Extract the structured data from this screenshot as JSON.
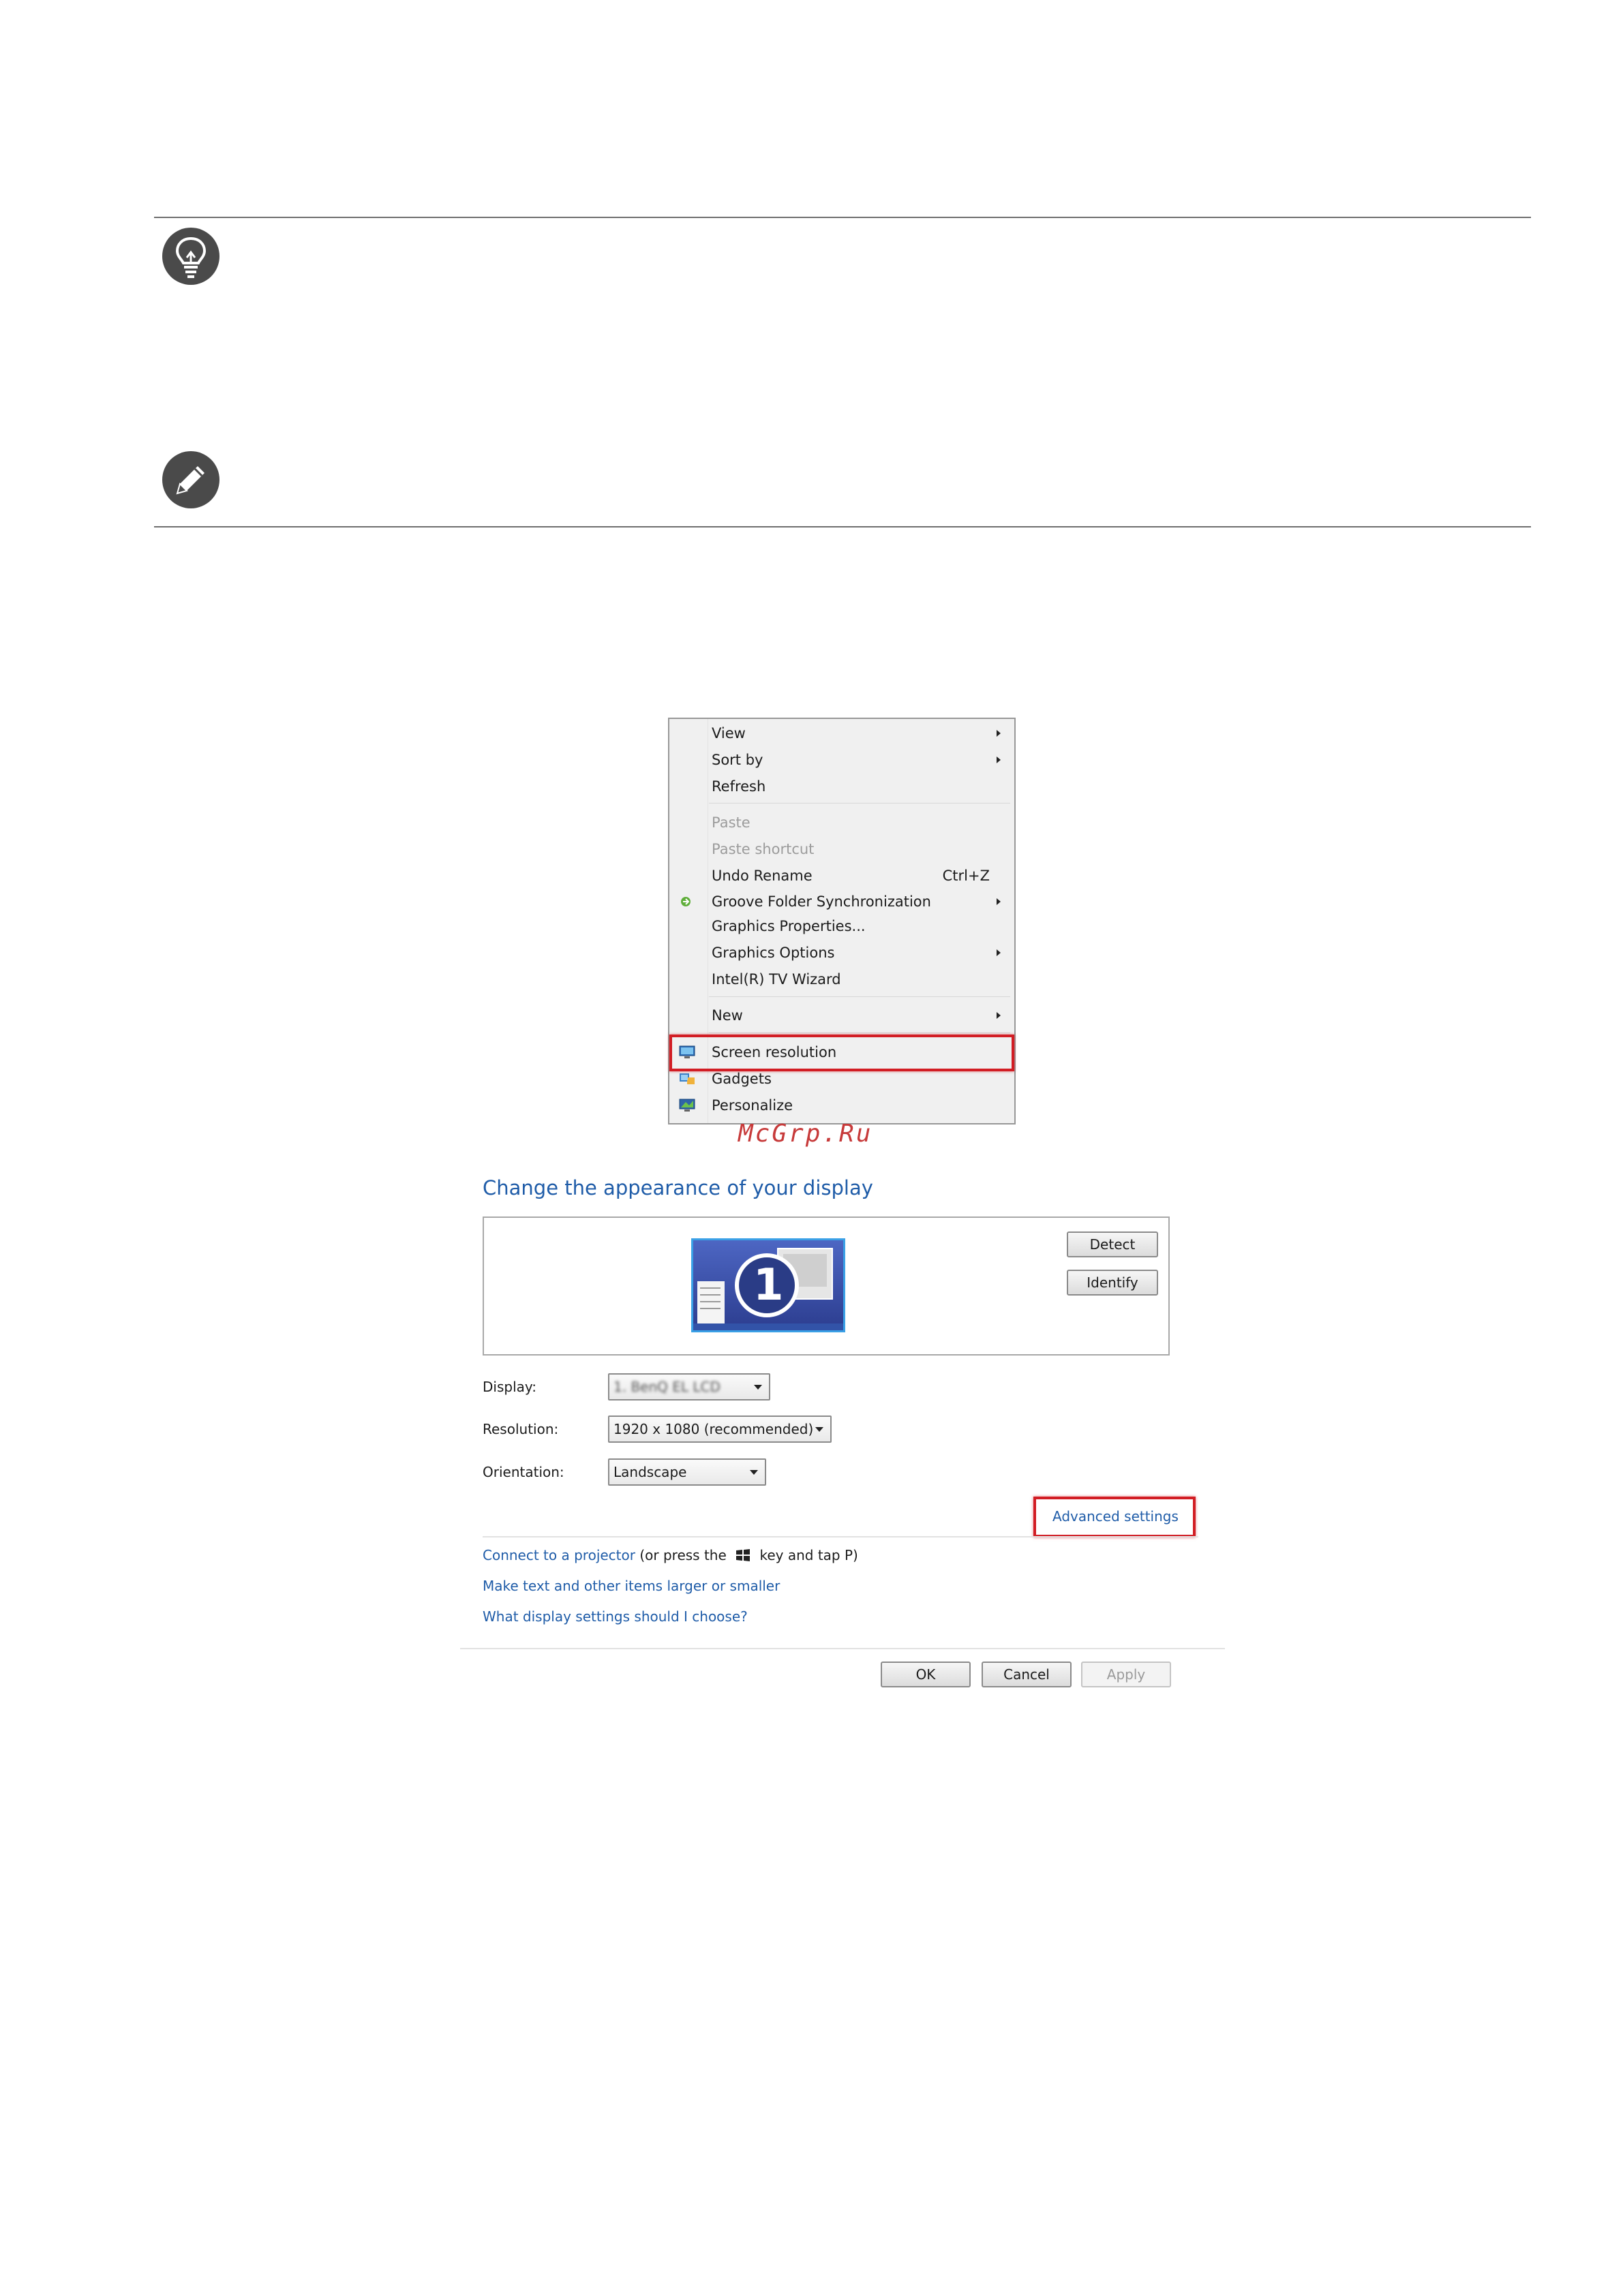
{
  "context_menu": {
    "items": [
      {
        "label": "View",
        "submenu": true
      },
      {
        "label": "Sort by",
        "submenu": true
      },
      {
        "label": "Refresh"
      },
      {
        "label": "Paste",
        "disabled": true
      },
      {
        "label": "Paste shortcut",
        "disabled": true
      },
      {
        "label": "Undo Rename",
        "shortcut": "Ctrl+Z"
      },
      {
        "label": "Groove Folder Synchronization",
        "submenu": true,
        "icon": "groove-icon"
      },
      {
        "label": "Graphics Properties..."
      },
      {
        "label": "Graphics Options",
        "submenu": true
      },
      {
        "label": "Intel(R) TV Wizard"
      },
      {
        "label": "New",
        "submenu": true
      },
      {
        "label": "Screen resolution",
        "icon": "screen-resolution-icon",
        "highlighted": true
      },
      {
        "label": "Gadgets",
        "icon": "gadgets-icon"
      },
      {
        "label": "Personalize",
        "icon": "personalize-icon"
      }
    ]
  },
  "watermark": "McGrp.Ru",
  "display_settings": {
    "heading": "Change the appearance of your display",
    "monitor_number": "1",
    "detect_label": "Detect",
    "identify_label": "Identify",
    "display_label": "Display:",
    "display_value": "1. BenQ EL LCD",
    "resolution_label": "Resolution:",
    "resolution_value": "1920 x 1080 (recommended)",
    "orientation_label": "Orientation:",
    "orientation_value": "Landscape",
    "advanced_settings_label": "Advanced settings",
    "connect_link": "Connect to a projector",
    "connect_suffix_a": "(or press the",
    "connect_suffix_b": "key and tap P)",
    "text_size_link": "Make text and other items larger or smaller",
    "help_link": "What display settings should I choose?",
    "ok_label": "OK",
    "cancel_label": "Cancel",
    "apply_label": "Apply"
  },
  "colors": {
    "highlight_box": "#d21d24",
    "link": "#1f5ca8",
    "note_icon": "#4a4a4a"
  }
}
